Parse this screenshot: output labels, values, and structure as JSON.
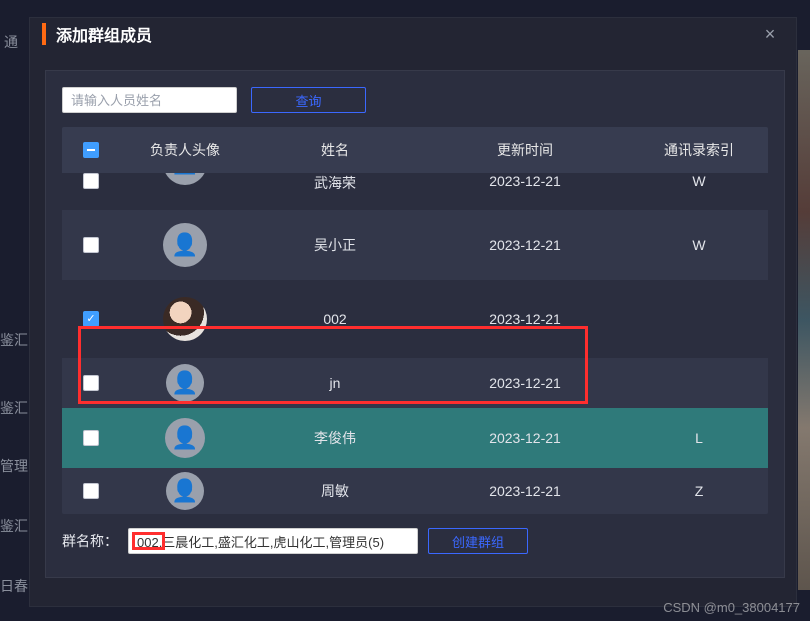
{
  "modal": {
    "title": "添加群组成员",
    "close_label": "×"
  },
  "search": {
    "placeholder": "请输入人员姓名",
    "query_label": "查询"
  },
  "table": {
    "header_select_state": "indeterminate",
    "columns": {
      "avatar": "负责人头像",
      "name": "姓名",
      "updated": "更新时间",
      "index": "通讯录索引"
    },
    "rows": [
      {
        "checked": false,
        "avatar": "default",
        "name": "武海荣",
        "updated": "2023-12-21",
        "index": "W",
        "partial": true
      },
      {
        "checked": false,
        "avatar": "default",
        "name": "吴小正",
        "updated": "2023-12-21",
        "index": "W"
      },
      {
        "checked": true,
        "avatar": "photo",
        "name": "002",
        "updated": "2023-12-21",
        "index": ""
      },
      {
        "checked": false,
        "avatar": "default",
        "name": "jn",
        "updated": "2023-12-21",
        "index": ""
      },
      {
        "checked": false,
        "avatar": "default",
        "name": "李俊伟",
        "updated": "2023-12-21",
        "index": "L",
        "hover": true
      },
      {
        "checked": false,
        "avatar": "default",
        "name": "周敏",
        "updated": "2023-12-21",
        "index": "Z"
      }
    ]
  },
  "footer": {
    "label": "群名称：",
    "group_name_value": "002,三晨化工,盛汇化工,虎山化工,管理员(5)",
    "create_label": "创建群组"
  },
  "bg_sidebar": [
    "通",
    "鉴汇",
    "鉴汇",
    "管理",
    "鉴汇",
    "日春"
  ],
  "watermark": "CSDN @m0_38004177"
}
